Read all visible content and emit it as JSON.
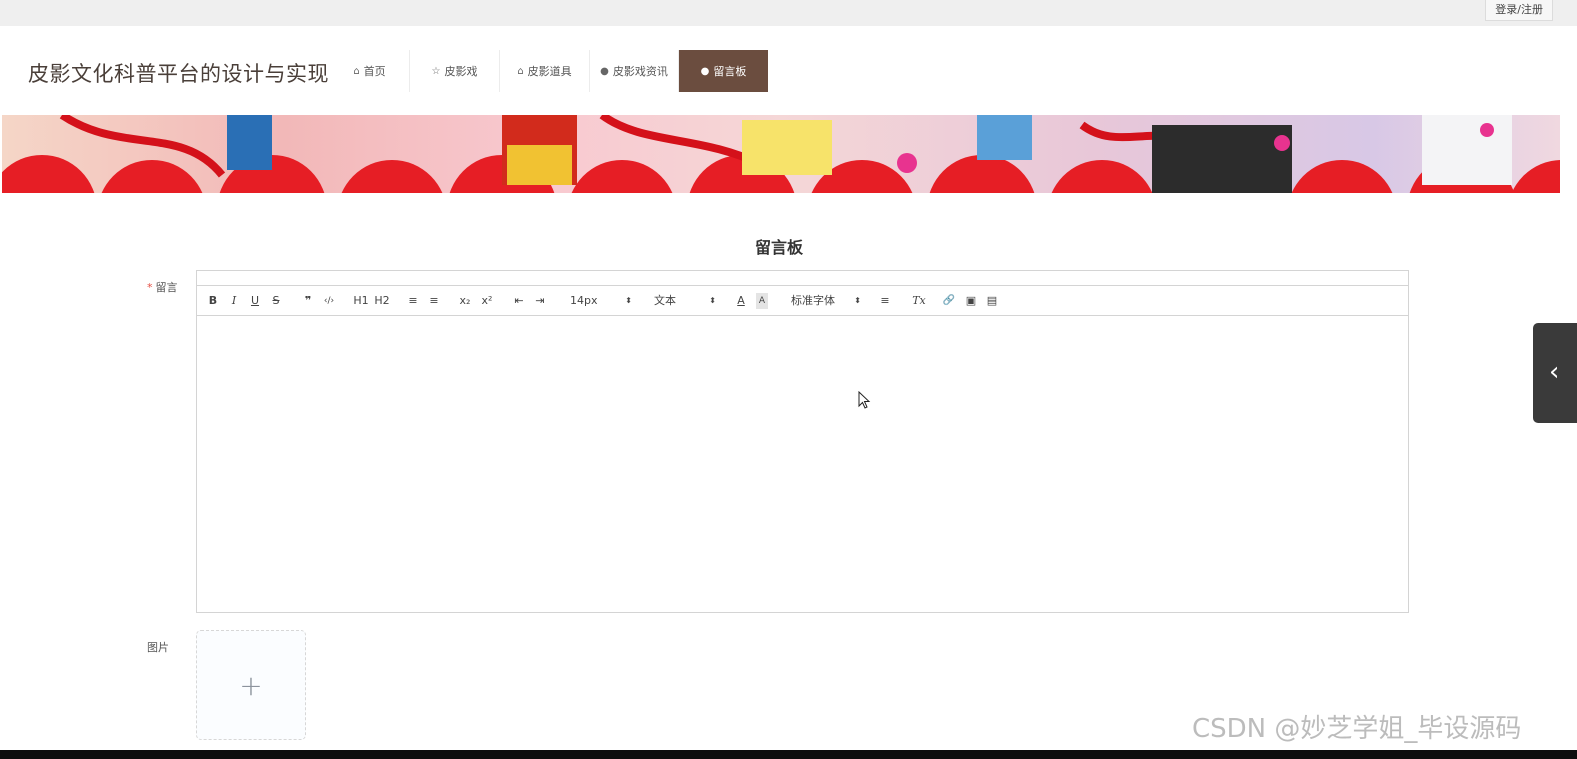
{
  "topbar": {
    "login_label": "登录/注册"
  },
  "site": {
    "title": "皮影文化科普平台的设计与实现"
  },
  "nav": [
    {
      "label": "首页",
      "icon": "home-icon"
    },
    {
      "label": "皮影戏",
      "icon": "star-icon"
    },
    {
      "label": "皮影道具",
      "icon": "bag-icon"
    },
    {
      "label": "皮影戏资讯",
      "icon": "info-icon"
    },
    {
      "label": "留言板",
      "icon": "question-icon",
      "active": true
    }
  ],
  "page": {
    "heading": "留言板"
  },
  "form": {
    "message_label": "留言",
    "required_mark": "*",
    "image_label": "图片"
  },
  "editor": {
    "toolbar": {
      "bold": "B",
      "italic": "I",
      "underline": "U",
      "strike": "S",
      "quote": "❞",
      "code": "‹/›",
      "h1": "H1",
      "h2": "H2",
      "ordered_list": "≡",
      "bullet_list": "≡",
      "subscript": "x₂",
      "superscript": "x²",
      "outdent": "⇤",
      "indent": "⇥",
      "font_size": "14px",
      "header_select": "文本",
      "color": "A",
      "background": "A",
      "font_family": "标准字体",
      "align": "≡",
      "clean": "Tx",
      "link": "🔗",
      "image": "▣",
      "video": "▤"
    },
    "content": ""
  },
  "uploader": {
    "plus": "+"
  },
  "watermark": "CSDN @妙芝学姐_毕设源码",
  "colors": {
    "nav_active": "#6b4d3f",
    "required": "#e54d42",
    "side_handle": "#3a3a3a"
  }
}
